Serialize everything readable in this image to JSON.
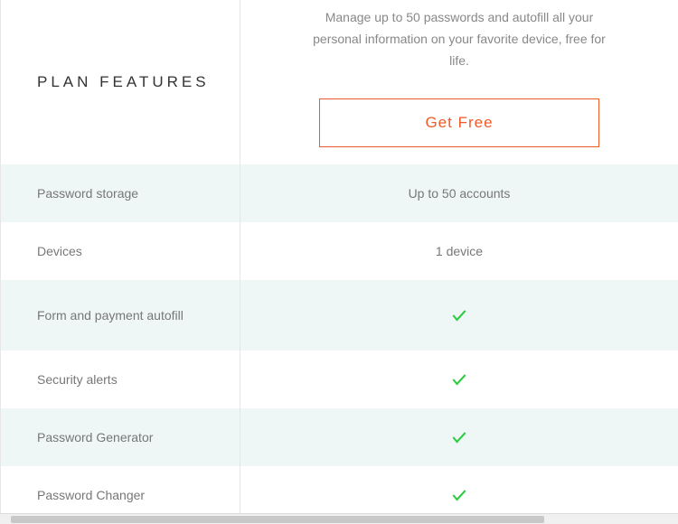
{
  "header": {
    "plan_features_label": "PLAN FEATURES",
    "plan_description": "Manage up to 50 passwords and autofill all your personal information on your favorite device, free for life.",
    "cta_label": "Get Free"
  },
  "features": [
    {
      "label": "Password storage",
      "value": "Up to 50 accounts",
      "check": false
    },
    {
      "label": "Devices",
      "value": "1 device",
      "check": false
    },
    {
      "label": "Form and payment autofill",
      "value": "",
      "check": true
    },
    {
      "label": "Security alerts",
      "value": "",
      "check": true
    },
    {
      "label": "Password Generator",
      "value": "",
      "check": true
    },
    {
      "label": "Password Changer",
      "value": "",
      "check": true
    }
  ],
  "colors": {
    "accent": "#f05a28",
    "check": "#2ecc40",
    "alt_row": "#eef6f6"
  }
}
